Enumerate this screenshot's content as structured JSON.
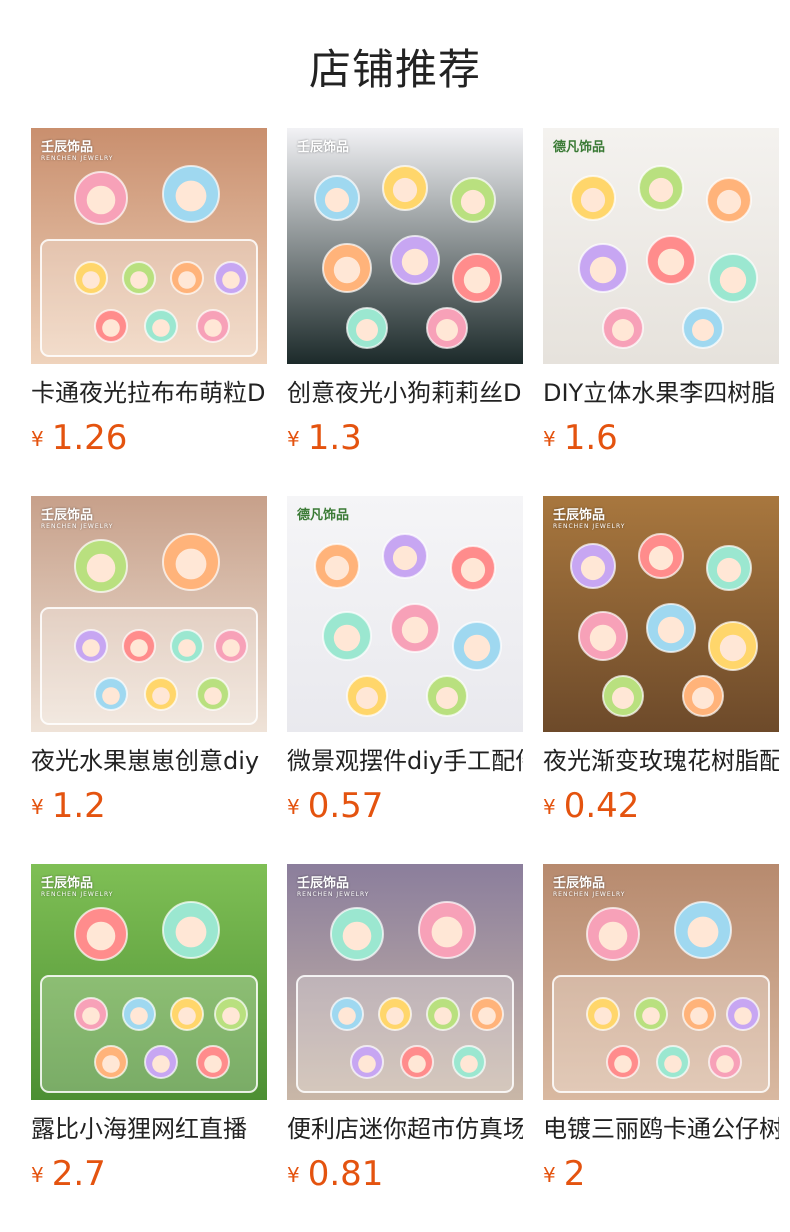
{
  "page_title": "店铺推荐",
  "currency_symbol": "¥",
  "products": [
    {
      "name": "卡通夜光拉布布萌粒DIY",
      "price": "1.26",
      "brand": "壬辰饰品",
      "brand_sub": "RENCHEN JEWELRY",
      "brand_style": "white",
      "bg": [
        "#c98f6e",
        "#efd3bc"
      ],
      "inset": true
    },
    {
      "name": "创意夜光小狗莉莉丝DIY",
      "price": "1.3",
      "brand": "壬辰饰品",
      "brand_sub": "",
      "brand_style": "white",
      "bg": [
        "#f2f2f5",
        "#1c2a2a"
      ],
      "inset": false
    },
    {
      "name": "DIY立体水果李四树脂",
      "price": "1.6",
      "brand": "德凡饰品",
      "brand_sub": "",
      "brand_style": "green",
      "bg": [
        "#f4f2ef",
        "#e6e2dc"
      ],
      "inset": false
    },
    {
      "name": "夜光水果崽崽创意diy",
      "price": "1.2",
      "brand": "壬辰饰品",
      "brand_sub": "RENCHEN JEWELRY",
      "brand_style": "white",
      "bg": [
        "#c7a08a",
        "#efe3d8"
      ],
      "inset": true
    },
    {
      "name": "微景观摆件diy手工配件",
      "price": "0.57",
      "brand": "德凡饰品",
      "brand_sub": "",
      "brand_style": "green",
      "bg": [
        "#f5f5f7",
        "#e9e9ee"
      ],
      "inset": false
    },
    {
      "name": "夜光渐变玫瑰花树脂配件",
      "price": "0.42",
      "brand": "壬辰饰品",
      "brand_sub": "RENCHEN JEWELRY",
      "brand_style": "white",
      "bg": [
        "#a8773e",
        "#6d4a2a"
      ],
      "inset": false
    },
    {
      "name": "露比小海狸网红直播",
      "price": "2.7",
      "brand": "壬辰饰品",
      "brand_sub": "RENCHEN JEWELRY",
      "brand_style": "white",
      "bg": [
        "#7fbf55",
        "#4c8f33"
      ],
      "inset": true
    },
    {
      "name": "便利店迷你超市仿真场景",
      "price": "0.81",
      "brand": "壬辰饰品",
      "brand_sub": "RENCHEN JEWELRY",
      "brand_style": "white",
      "bg": [
        "#8b7e9c",
        "#c9b7a7"
      ],
      "inset": true
    },
    {
      "name": "电镀三丽鸥卡通公仔树脂",
      "price": "2",
      "brand": "壬辰饰品",
      "brand_sub": "RENCHEN JEWELRY",
      "brand_style": "white",
      "bg": [
        "#b78a6e",
        "#d9b9a1"
      ],
      "inset": true
    }
  ],
  "colors": {
    "price": "#e4530f",
    "text": "#222222",
    "background": "#ffffff"
  }
}
